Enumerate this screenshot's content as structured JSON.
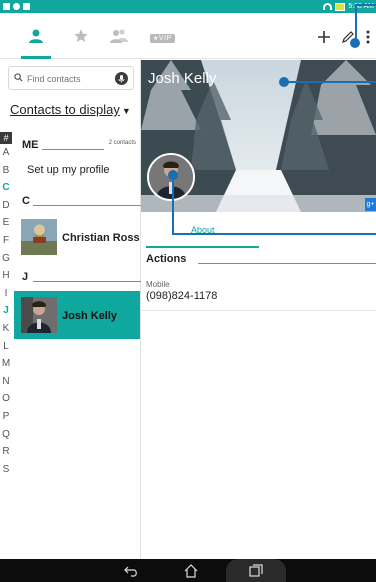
{
  "status_bar": {
    "time": "5:38 AM"
  },
  "toolbar": {
    "tabs": [
      {
        "name": "contacts",
        "icon": "person-icon",
        "active": true
      },
      {
        "name": "favorites",
        "icon": "star-icon",
        "active": false
      },
      {
        "name": "groups",
        "icon": "people-icon",
        "active": false
      }
    ],
    "vip_label": "VIP",
    "actions": [
      {
        "name": "add",
        "icon": "plus-icon"
      },
      {
        "name": "edit",
        "icon": "pencil-icon"
      },
      {
        "name": "more",
        "icon": "overflow-menu-icon"
      }
    ]
  },
  "contacts_list": {
    "search_placeholder": "Find contacts",
    "display_toggle_label": "Contacts to display",
    "index_letters": [
      "#",
      "A",
      "B",
      "C",
      "D",
      "E",
      "F",
      "G",
      "H",
      "I",
      "J",
      "K",
      "L",
      "M",
      "N",
      "O",
      "P",
      "Q",
      "R",
      "S"
    ],
    "highlighted_letters": [
      "C",
      "J"
    ],
    "sections": [
      {
        "header": "ME",
        "count": "2 contacts"
      },
      {
        "header": "C"
      },
      {
        "header": "J"
      }
    ],
    "setup_profile_label": "Set up my profile",
    "items": [
      {
        "name": "Christian Ross",
        "selected": false
      },
      {
        "name": "Josh Kelly",
        "selected": true
      }
    ]
  },
  "detail": {
    "contact_name": "Josh Kelly",
    "tab_about": "About",
    "actions_header": "Actions",
    "phone_label": "Mobile",
    "phone_value": "(098)824-1178",
    "account_badge": "g+"
  },
  "colors": {
    "accent": "#10a79e",
    "callout": "#1a6fb2",
    "navbar": "#0c0c0c"
  }
}
